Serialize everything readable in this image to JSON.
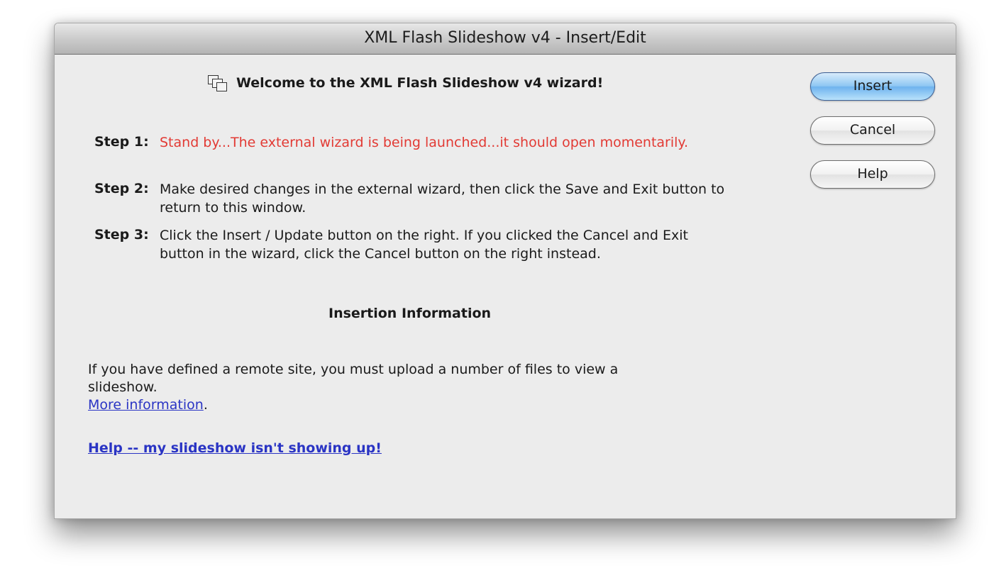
{
  "window": {
    "title": "XML Flash Slideshow v4 - Insert/Edit"
  },
  "welcome": {
    "icon": "wizard-windows-icon",
    "text": "Welcome to the XML Flash Slideshow v4 wizard!"
  },
  "steps": [
    {
      "label": "Step 1:",
      "text": "Stand by...The external wizard is being launched...it should open momentarily.",
      "color": "#e23a34"
    },
    {
      "label": "Step 2:",
      "text": "Make desired changes in the external wizard, then click the Save and Exit button to return to this window."
    },
    {
      "label": "Step 3:",
      "text": "Click the Insert / Update button on the right.  If you clicked the Cancel and Exit button in the wizard, click the Cancel button on the right instead."
    }
  ],
  "insertion": {
    "title": "Insertion Information",
    "text": "If you have defined a remote site, you must upload a number of files to view a slideshow.",
    "more_link": "More information",
    "more_suffix": ".",
    "help_link": "Help -- my slideshow isn't showing up!"
  },
  "buttons": {
    "insert": "Insert",
    "cancel": "Cancel",
    "help": "Help"
  },
  "colors": {
    "link": "#2a34c4",
    "warning": "#e23a34",
    "primary_button": "#6fb3ee"
  }
}
